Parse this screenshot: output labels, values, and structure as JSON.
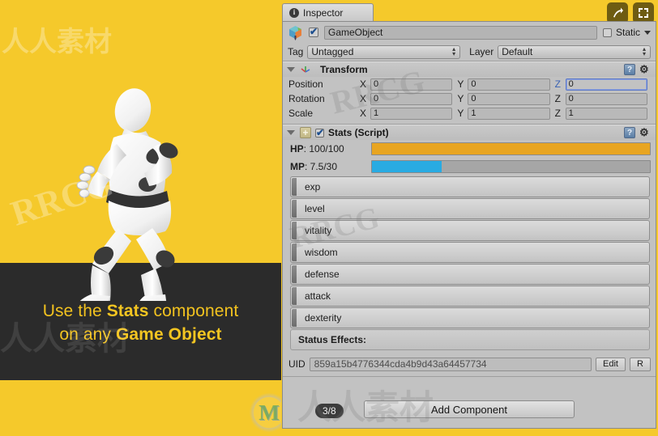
{
  "promo": {
    "caption_line1_pre": "Use the ",
    "caption_line1_bold": "Stats",
    "caption_line1_post": " component",
    "caption_line2_pre": "on any ",
    "caption_line2_bold": "Game Object",
    "logo_letter": "M",
    "background_color": "#f5c92b",
    "floor_color": "#2b2b2b",
    "caption_color": "#f2c21f"
  },
  "watermarks": {
    "a": "人人素材",
    "b": "RRCG",
    "c": "RRCG",
    "d": "人人素材",
    "e": "RRCG"
  },
  "inspector": {
    "tab_label": "Inspector",
    "tab_icon": "info-circle-icon",
    "top_buttons": [
      {
        "name": "share-arrow-icon",
        "glyph": "➜"
      },
      {
        "name": "maximize-icon",
        "glyph": "⛶"
      }
    ],
    "object_header": {
      "icon": "gameobject-cube-icon",
      "enabled": true,
      "name_value": "GameObject",
      "static_label": "Static",
      "static_checked": false,
      "static_dropdown_icon": "chevron-down-icon"
    },
    "tag_layer": {
      "tag_label": "Tag",
      "tag_value": "Untagged",
      "layer_label": "Layer",
      "layer_value": "Default"
    },
    "transform": {
      "title": "Transform",
      "icon": "transform-axis-icon",
      "help_icon": "help-book-icon",
      "gear_icon": "gear-icon",
      "rows": [
        {
          "label": "Position",
          "axes": [
            {
              "axis": "X",
              "value": "0",
              "focused": false
            },
            {
              "axis": "Y",
              "value": "0",
              "focused": false
            },
            {
              "axis": "Z",
              "value": "0",
              "focused": true
            }
          ]
        },
        {
          "label": "Rotation",
          "axes": [
            {
              "axis": "X",
              "value": "0",
              "focused": false
            },
            {
              "axis": "Y",
              "value": "0",
              "focused": false
            },
            {
              "axis": "Z",
              "value": "0",
              "focused": false
            }
          ]
        },
        {
          "label": "Scale",
          "axes": [
            {
              "axis": "X",
              "value": "1",
              "focused": false
            },
            {
              "axis": "Y",
              "value": "1",
              "focused": false
            },
            {
              "axis": "Z",
              "value": "1",
              "focused": false
            }
          ]
        }
      ]
    },
    "stats_component": {
      "title": "Stats (Script)",
      "enabled": true,
      "script_icon": "script-plus-icon",
      "help_icon": "help-book-icon",
      "gear_icon": "gear-icon",
      "bars": [
        {
          "label_key": "HP",
          "label_value": ": 100/100",
          "current": 100,
          "max": 100,
          "percent": 100,
          "color": "#e8a521"
        },
        {
          "label_key": "MP",
          "label_value": ": 7.5/30",
          "current": 7.5,
          "max": 30,
          "percent": 25,
          "color": "#29abe2"
        }
      ],
      "foldouts": [
        "exp",
        "level",
        "vitality",
        "wisdom",
        "defense",
        "attack",
        "dexterity"
      ],
      "status_effects_label": "Status Effects:"
    },
    "uid_row": {
      "label": "UID",
      "value": "859a15b4776344cda4b9d43a64457734",
      "edit_button": "Edit",
      "r_button": "R"
    },
    "footer": {
      "add_component": "Add Component",
      "page_badge": "3/8"
    }
  }
}
